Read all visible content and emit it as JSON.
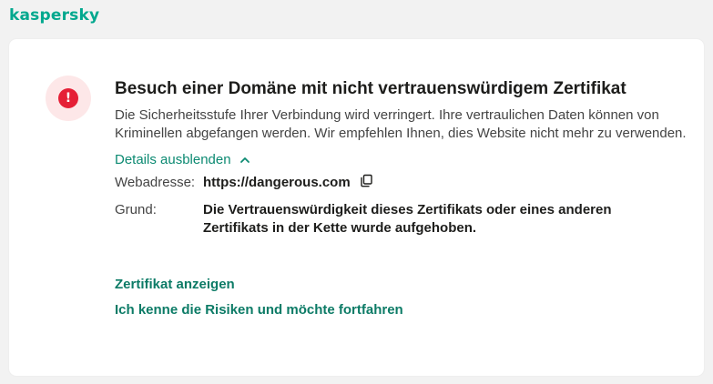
{
  "brand": {
    "name": "kaspersky",
    "color": "#00a88e"
  },
  "alert": {
    "icon": "alert-icon",
    "glyph": "!",
    "title": "Besuch einer Domäne mit nicht vertrauenswürdigem Zertifikat",
    "description": "Die Sicherheitsstufe Ihrer Verbindung wird verringert. Ihre vertraulichen Daten können von Kriminellen abgefangen werden. Wir empfehlen Ihnen, dies Website nicht mehr zu verwenden."
  },
  "details": {
    "toggle_label": "Details ausblenden",
    "url_label": "Webadresse:",
    "url_value": "https://dangerous.com",
    "reason_label": "Grund:",
    "reason_value": "Die Vertrauenswürdigkeit dieses Zertifikats oder eines anderen Zertifikats in der Kette wurde aufgehoben."
  },
  "actions": {
    "show_certificate": "Zertifikat anzeigen",
    "proceed": "Ich kenne die Risiken und möchte fortfahren"
  },
  "colors": {
    "accent": "#0c8a72",
    "danger": "#e51f36",
    "danger_bg": "#fde7e8"
  }
}
